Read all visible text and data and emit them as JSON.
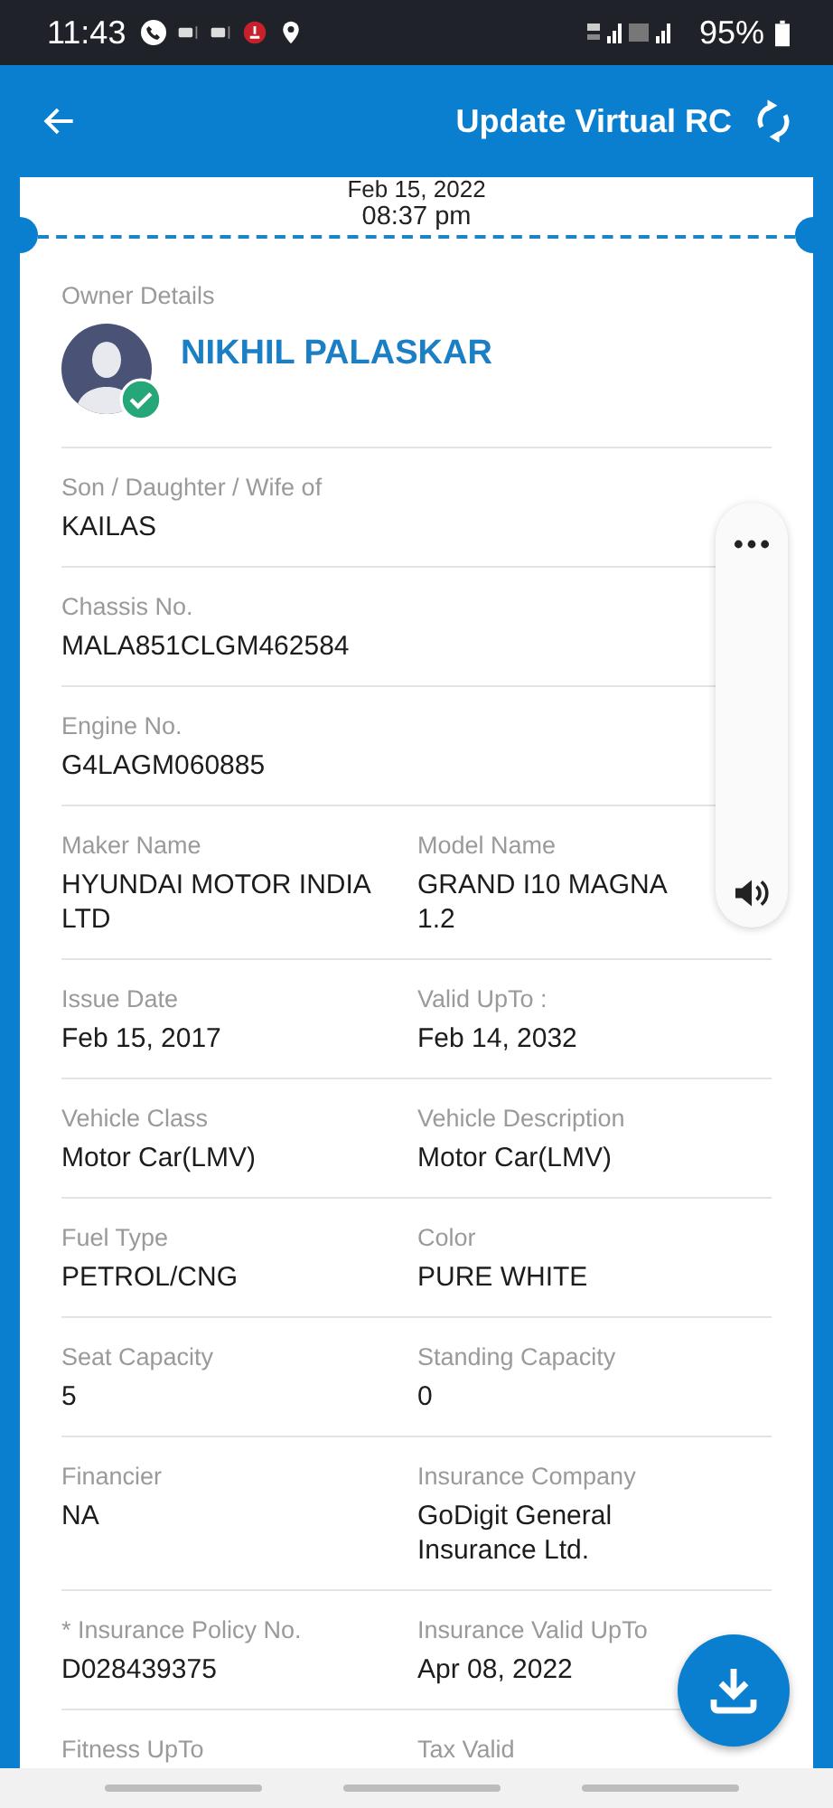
{
  "status_bar": {
    "time": "11:43",
    "battery": "95%"
  },
  "app_bar": {
    "title": "Update Virtual RC"
  },
  "card": {
    "date": "Feb 15, 2022",
    "time": "08:37 pm"
  },
  "owner": {
    "section_label": "Owner Details",
    "name": "NIKHIL PALASKAR",
    "verified": true
  },
  "rows": [
    {
      "fields": [
        {
          "label": "Son / Daughter / Wife of",
          "value": "KAILAS"
        }
      ]
    },
    {
      "fields": [
        {
          "label": "Chassis No.",
          "value": "MALA851CLGM462584"
        }
      ]
    },
    {
      "fields": [
        {
          "label": "Engine No.",
          "value": "G4LAGM060885"
        }
      ]
    },
    {
      "fields": [
        {
          "label": "Maker Name",
          "value": "HYUNDAI MOTOR INDIA LTD"
        },
        {
          "label": "Model Name",
          "value": "GRAND I10 MAGNA 1.2"
        }
      ]
    },
    {
      "fields": [
        {
          "label": "Issue Date",
          "value": "Feb 15, 2017"
        },
        {
          "label": "Valid UpTo :",
          "value": "Feb 14, 2032"
        }
      ]
    },
    {
      "fields": [
        {
          "label": "Vehicle Class",
          "value": "Motor Car(LMV)"
        },
        {
          "label": "Vehicle Description",
          "value": "Motor Car(LMV)"
        }
      ]
    },
    {
      "fields": [
        {
          "label": "Fuel Type",
          "value": "PETROL/CNG"
        },
        {
          "label": "Color",
          "value": "PURE WHITE"
        }
      ]
    },
    {
      "fields": [
        {
          "label": "Seat Capacity",
          "value": "5"
        },
        {
          "label": "Standing Capacity",
          "value": "0"
        }
      ]
    },
    {
      "fields": [
        {
          "label": "Financier",
          "value": "NA"
        },
        {
          "label": "Insurance Company",
          "value": "GoDigit General Insurance Ltd."
        }
      ]
    },
    {
      "fields": [
        {
          "label": "* Insurance Policy No.",
          "value": "D028439375"
        },
        {
          "label": "Insurance Valid UpTo",
          "value": "Apr 08, 2022"
        }
      ]
    },
    {
      "fields": [
        {
          "label": "Fitness UpTo"
        },
        {
          "label": "Tax Valid"
        }
      ]
    }
  ]
}
